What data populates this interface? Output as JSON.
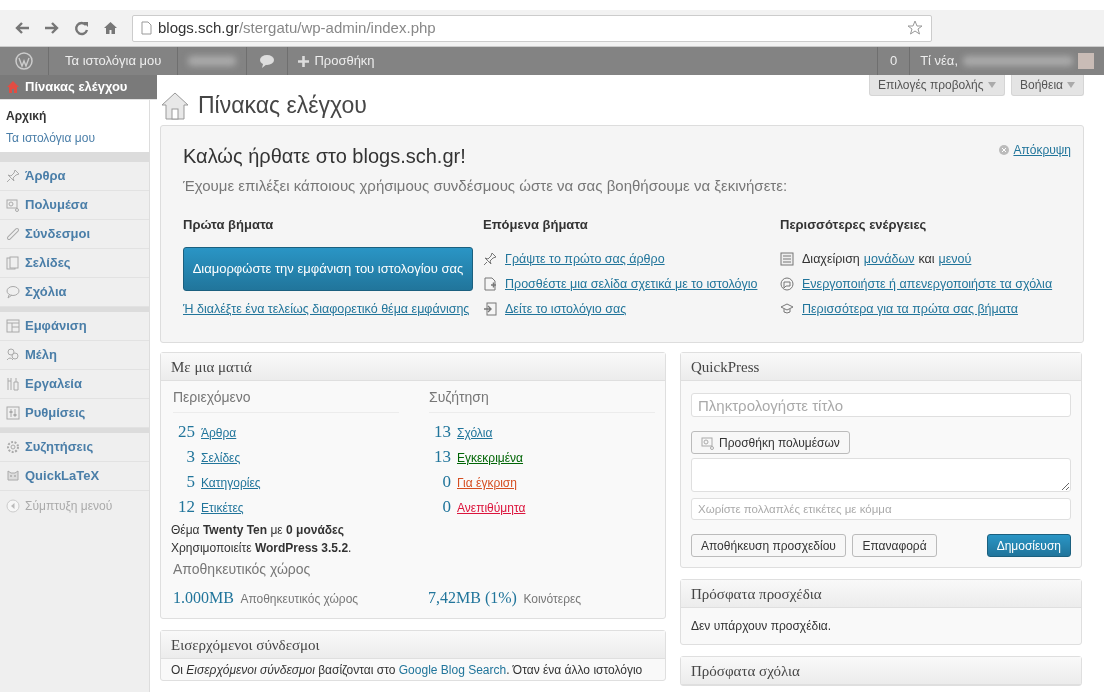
{
  "browser": {
    "url_host": "blogs.sch.gr",
    "url_path": "/stergatu/wp-admin/index.php"
  },
  "admin_bar": {
    "sites_label": "Τα ιστολόγια μου",
    "new_label": "Προσθήκη",
    "count": "0",
    "greeting": "Τί νέα,"
  },
  "sidebar": {
    "items": [
      {
        "label": "Πίνακας ελέγχου",
        "selected": true,
        "separator_before": false,
        "children": [
          {
            "label": "Αρχική",
            "selected": true
          },
          {
            "label": "Τα ιστολόγια μου",
            "selected": false
          }
        ]
      },
      {
        "label": "Άρθρα",
        "selected": false,
        "separator_before": true
      },
      {
        "label": "Πολυμέσα",
        "selected": false,
        "separator_before": false
      },
      {
        "label": "Σύνδεσμοι",
        "selected": false,
        "separator_before": false
      },
      {
        "label": "Σελίδες",
        "selected": false,
        "separator_before": false
      },
      {
        "label": "Σχόλια",
        "selected": false,
        "separator_before": false
      },
      {
        "label": "Εμφάνιση",
        "selected": false,
        "separator_before": true
      },
      {
        "label": "Μέλη",
        "selected": false,
        "separator_before": false
      },
      {
        "label": "Εργαλεία",
        "selected": false,
        "separator_before": false
      },
      {
        "label": "Ρυθμίσεις",
        "selected": false,
        "separator_before": false
      },
      {
        "label": "Συζητήσεις",
        "selected": false,
        "separator_before": true
      },
      {
        "label": "QuickLaTeX",
        "selected": false,
        "separator_before": false
      }
    ],
    "collapse_label": "Σύμπτυξη μενού"
  },
  "screen_buttons": [
    "Επιλογές προβολής",
    "Βοήθεια"
  ],
  "page_title": "Πίνακας ελέγχου",
  "welcome": {
    "title": "Καλώς ήρθατε στο blogs.sch.gr!",
    "subtitle": "Έχουμε επιλέξει κάποιους χρήσιμους συνδέσμους ώστε να σας βοηθήσουμε να ξεκινήσετε:",
    "dismiss": "Απόκρυψη",
    "columns": [
      {
        "heading": "Πρώτα βήματα",
        "items": [
          {
            "kind": "button",
            "parts": [
              {
                "text": "Διαμορφώστε την εμφάνιση του ιστολογίου σας",
                "link": false
              }
            ]
          },
          {
            "kind": "line",
            "parts": [
              {
                "text": "Ή διαλέξτε ένα τελείως διαφορετικό θέμα εμφάνισης",
                "link": true
              }
            ]
          }
        ]
      },
      {
        "heading": "Επόμενα βήματα",
        "items": [
          {
            "kind": "line",
            "parts": [
              {
                "text": "Γράψτε το πρώτο σας άρθρο",
                "link": true
              }
            ]
          },
          {
            "kind": "line",
            "parts": [
              {
                "text": "Προσθέστε μια σελίδα σχετικά με το ιστολόγιο",
                "link": true
              }
            ]
          },
          {
            "kind": "line",
            "parts": [
              {
                "text": "Δείτε το ιστολόγιο σας",
                "link": true
              }
            ]
          }
        ]
      },
      {
        "heading": "Περισσότερες ενέργειες",
        "items": [
          {
            "kind": "line",
            "parts": [
              {
                "text": "Διαχείριση",
                "link": false
              },
              {
                "text": "μονάδων",
                "link": true
              },
              {
                "text": "και",
                "link": false
              },
              {
                "text": "μενού",
                "link": true
              }
            ]
          },
          {
            "kind": "line",
            "parts": [
              {
                "text": "Ενεργοποιήστε ή απενεργοποιήστε τα σχόλια",
                "link": true
              }
            ]
          },
          {
            "kind": "line",
            "parts": [
              {
                "text": "Περισσότερα για τα πρώτα σας βήματα",
                "link": true
              }
            ]
          }
        ]
      }
    ]
  },
  "glance": {
    "title": "Με μια ματιά",
    "content": {
      "heading": "Περιεχόμενο",
      "rows": [
        {
          "count": "25",
          "label": "Άρθρα"
        },
        {
          "count": "3",
          "label": "Σελίδες"
        },
        {
          "count": "5",
          "label": "Κατηγορίες"
        },
        {
          "count": "12",
          "label": "Ετικέτες"
        }
      ]
    },
    "discussion": {
      "heading": "Συζήτηση",
      "rows": [
        {
          "count": "13",
          "label": "Σχόλια",
          "color": "#21759b"
        },
        {
          "count": "13",
          "label": "Εγκεκριμένα",
          "color": "#006505"
        },
        {
          "count": "0",
          "label": "Για έγκριση",
          "color": "#d54e21"
        },
        {
          "count": "0",
          "label": "Ανεπιθύμητα",
          "color": "#dc143c"
        }
      ]
    },
    "theme_line": "Θέμα **Twenty Ten** με **0 μονάδες**",
    "version_line": "Χρησιμοποιείτε **WordPress 3.5.2**.",
    "storage": {
      "heading": "Αποθηκευτικός χώρος",
      "items": [
        {
          "amount": "1.000MB",
          "label": "Αποθηκευτικός χώρος"
        },
        {
          "amount": "7,42MB (1%)",
          "label": "Κοινότερες"
        }
      ]
    }
  },
  "incoming": {
    "title": "Εισερχόμενοι σύνδεσμοι",
    "parts": [
      {
        "kind": "plain",
        "text": "Οι "
      },
      {
        "kind": "italic",
        "text": "Εισερχόμενοι σύνδεσμοι"
      },
      {
        "kind": "plain",
        "text": " βασίζονται στο "
      },
      {
        "kind": "link",
        "text": "Google Blog Search"
      },
      {
        "kind": "plain",
        "text": ". Όταν ένα άλλο ιστολόγιο"
      }
    ]
  },
  "quickpress": {
    "title": "QuickPress",
    "title_placeholder": "Πληκτρολογήστε τίτλο",
    "media_button": "Προσθήκη πολυμέσων",
    "tags_placeholder": "Χωρίστε πολλαπλές ετικέτες με κόμμα",
    "buttons": [
      {
        "label": "Αποθήκευση προσχεδίου",
        "kind": "secondary"
      },
      {
        "label": "Επαναφορά",
        "kind": "secondary"
      },
      {
        "label": "Δημοσίευση",
        "kind": "primary"
      }
    ]
  },
  "drafts": {
    "title": "Πρόσφατα προσχέδια",
    "text": "Δεν υπάρχουν προσχέδια."
  },
  "recent_comments": {
    "title": "Πρόσφατα σχόλια"
  }
}
